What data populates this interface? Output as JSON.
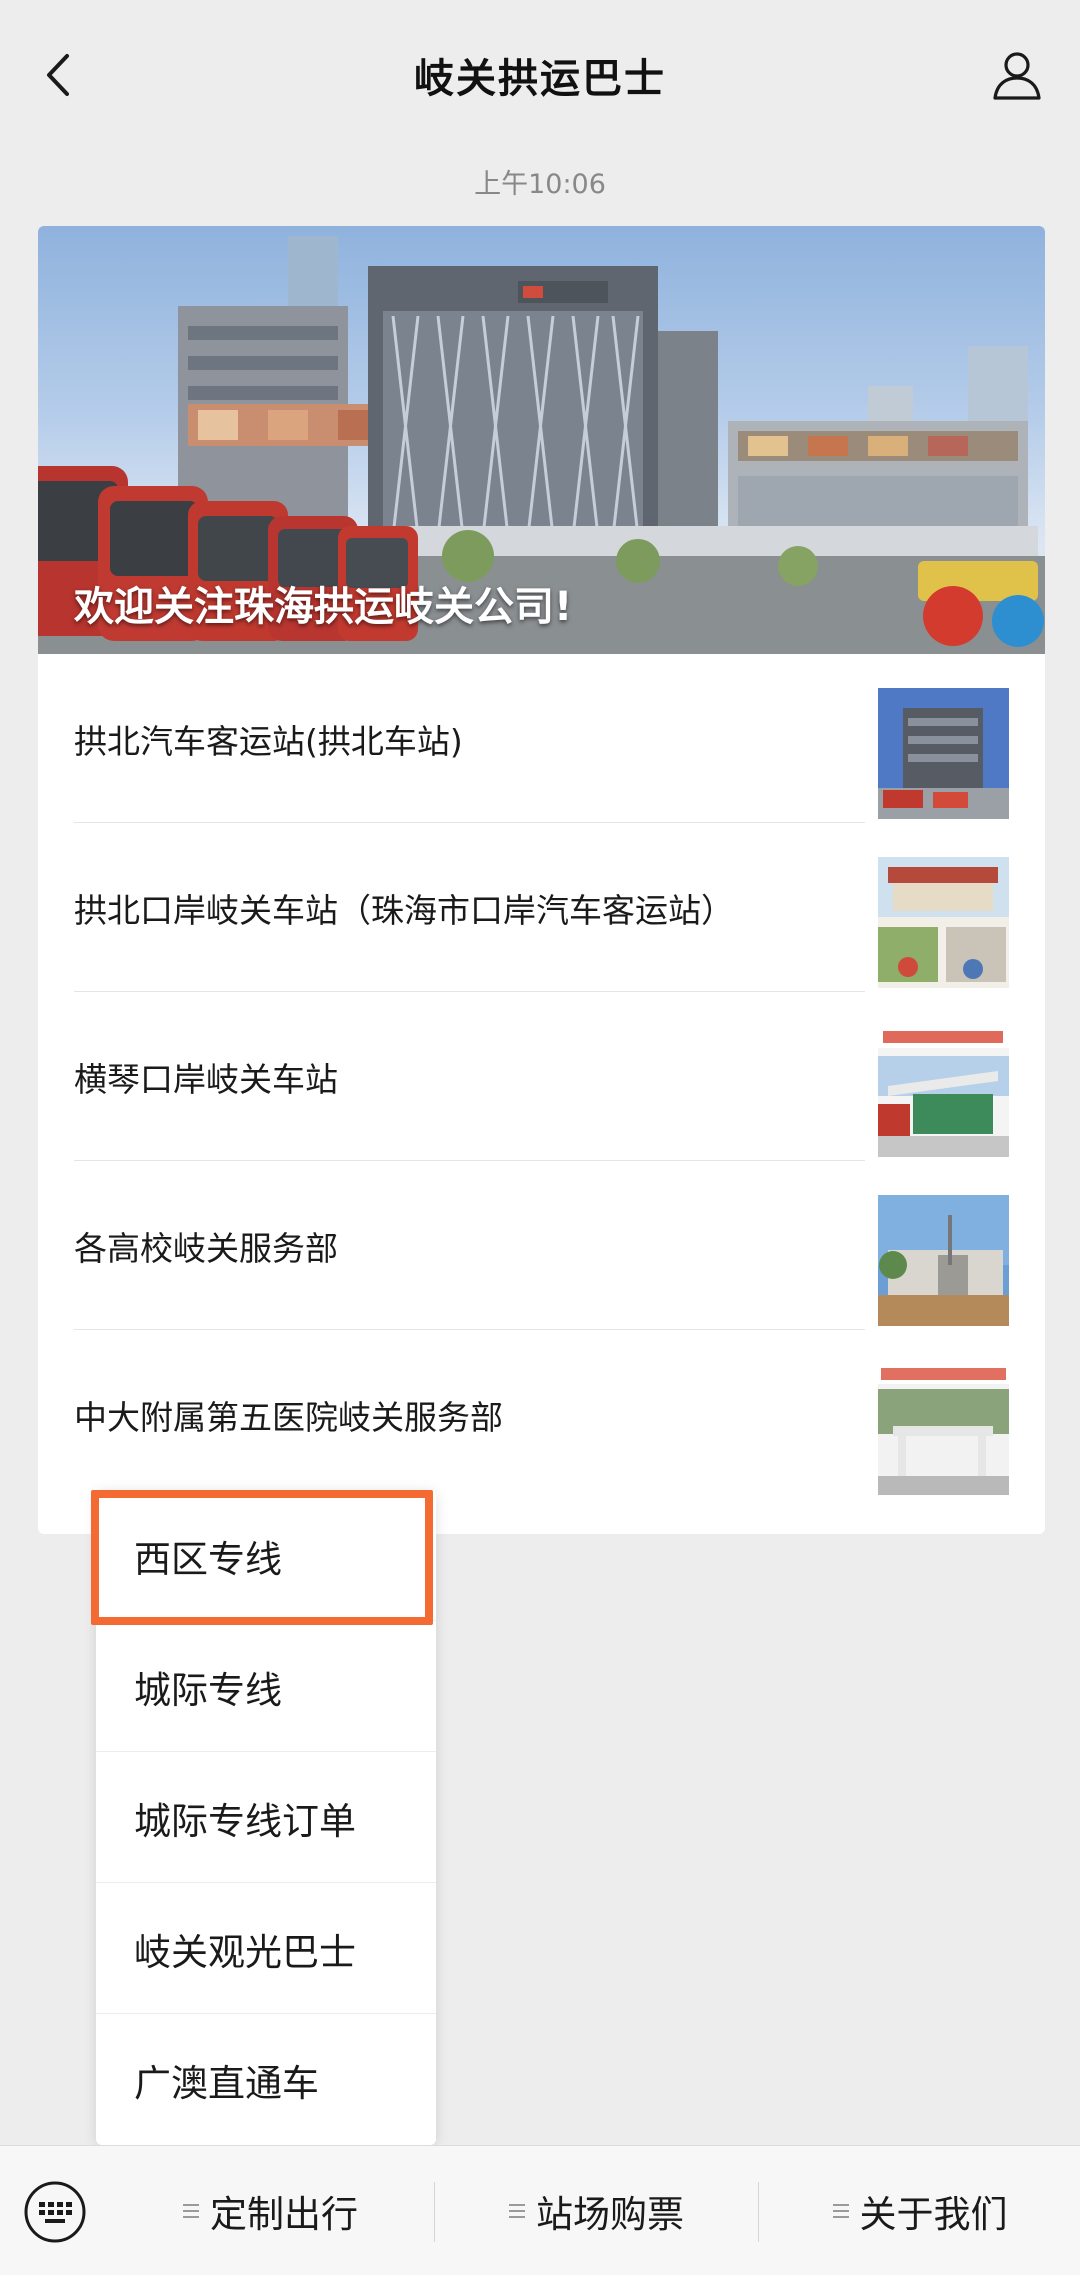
{
  "header": {
    "title": "岐关拱运巴士"
  },
  "message": {
    "time": "上午10:06"
  },
  "article": {
    "banner_caption": "欢迎关注珠海拱运岐关公司!",
    "items": [
      {
        "title": "拱北汽车客运站(拱北车站)"
      },
      {
        "title": "拱北口岸岐关车站（珠海市口岸汽车客运站）"
      },
      {
        "title": "横琴口岸岐关车站"
      },
      {
        "title": "各高校岐关服务部"
      },
      {
        "title": "中大附属第五医院岐关服务部"
      }
    ]
  },
  "popup_menu": {
    "items": [
      "西区专线",
      "城际专线",
      "城际专线订单",
      "岐关观光巴士",
      "广澳直通车"
    ],
    "highlighted_index": 0,
    "highlight_color": "#f46a33"
  },
  "bottom_menu": {
    "items": [
      "定制出行",
      "站场购票",
      "关于我们"
    ]
  },
  "icons": {
    "back": "chevron-left-icon",
    "profile": "person-icon",
    "keyboard": "keyboard-icon",
    "menu_lines": "menu-lines-icon"
  }
}
